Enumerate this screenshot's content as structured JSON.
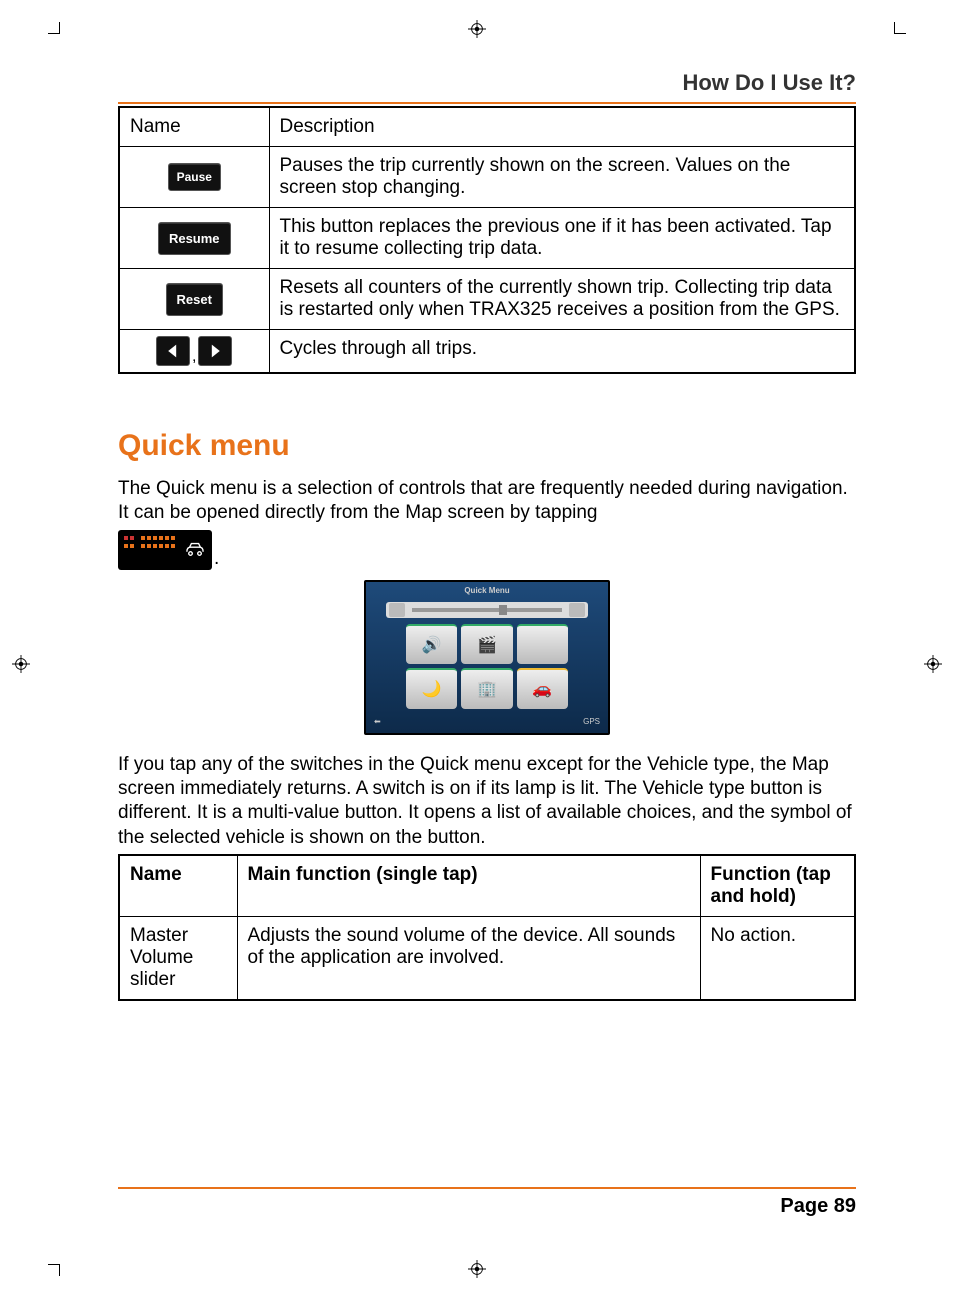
{
  "header": {
    "section_title": "How Do I Use It?"
  },
  "table1": {
    "headers": {
      "name": "Name",
      "description": "Description"
    },
    "rows": [
      {
        "btn_label": "Pause",
        "desc": "Pauses the trip currently shown on the screen. Values on the screen stop changing."
      },
      {
        "btn_label": "Resume",
        "desc": "This button replaces the previous one if it has been activated. Tap it to resume collecting trip data."
      },
      {
        "btn_label": "Reset",
        "desc": "Resets all counters of the currently shown trip. Collecting trip data is restarted only when TRAX325 receives a position from the GPS."
      },
      {
        "btn_label": "arrows",
        "desc": "Cycles through all trips."
      }
    ]
  },
  "quick": {
    "heading": "Quick menu",
    "p1": "The Quick menu is a selection of controls that are frequently needed during navigation. It can be opened directly from the Map screen by tapping",
    "period": ".",
    "screenshot_title": "Quick Menu",
    "screenshot_gps": "GPS",
    "p2": "If you tap any of the switches in the Quick menu except for the Vehicle type, the Map screen immediately returns. A switch is on if its lamp is lit. The Vehicle type button is different. It is a multi-value button. It opens a list of available choices, and the symbol of the selected vehicle is shown on the button."
  },
  "table2": {
    "headers": {
      "name": "Name",
      "main": "Main function (single tap)",
      "hold": "Function (tap and hold)"
    },
    "rows": [
      {
        "name": "Master Volume slider",
        "main": "Adjusts the sound volume of the device. All sounds of the application are involved.",
        "hold": "No action."
      }
    ]
  },
  "footer": {
    "page": "Page 89"
  }
}
